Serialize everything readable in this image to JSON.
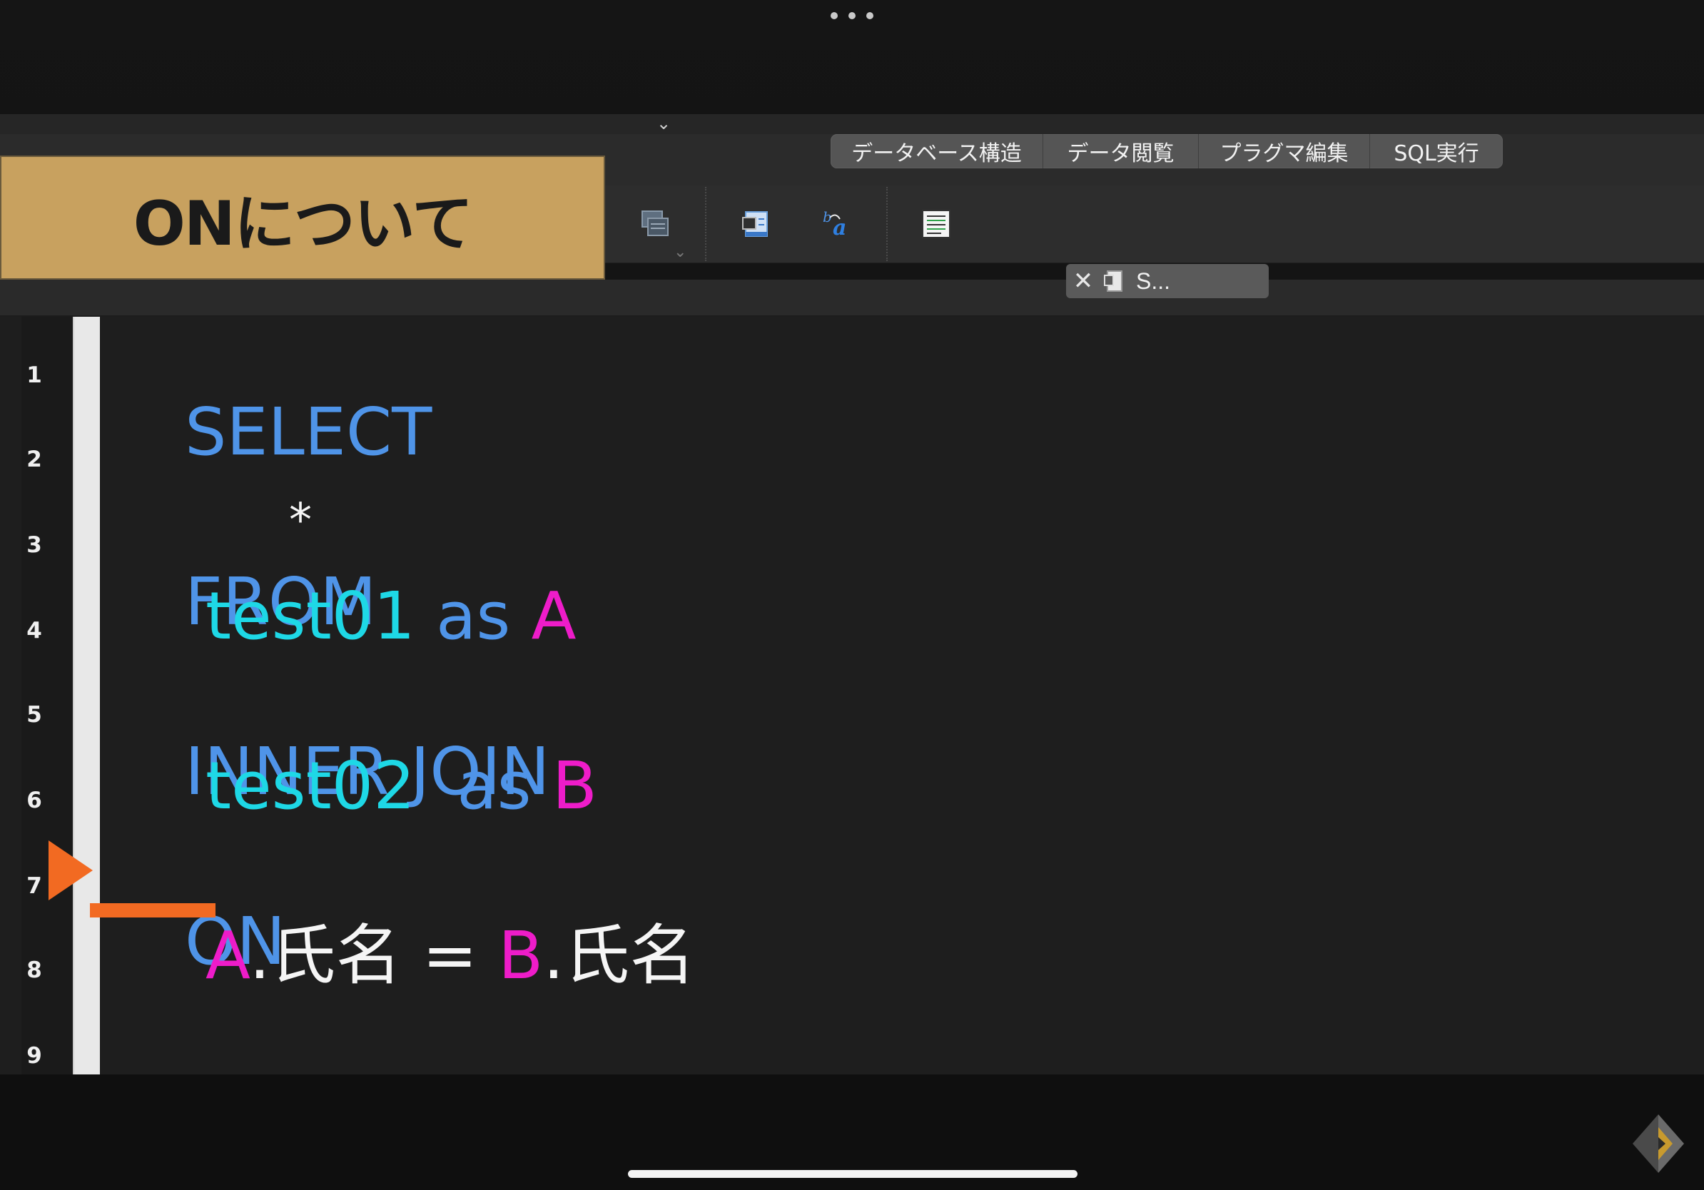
{
  "title_banner": "ONについて",
  "tabs": [
    {
      "label": "データベース構造"
    },
    {
      "label": "データ閲覧"
    },
    {
      "label": "プラグマ編集"
    },
    {
      "label": "SQL実行"
    }
  ],
  "document_tab": {
    "label": "S..."
  },
  "toolbar_icons": [
    "open-tab-icon",
    "open-sql-file-icon",
    "save-sql-icon",
    "find-replace-icon",
    "comment-icon"
  ],
  "editor": {
    "line_numbers": [
      "1",
      "2",
      "3",
      "4",
      "5",
      "6",
      "7",
      "8",
      "9"
    ],
    "line1": {
      "kw": "SELECT"
    },
    "line2": {
      "plain": "*"
    },
    "line3": {
      "kw": "FROM"
    },
    "line4": {
      "tbl": "test01",
      "kw": "as",
      "alias": "A"
    },
    "line5": {
      "kw": "INNER JOIN"
    },
    "line6": {
      "tbl": "test02",
      "kw": "as",
      "alias": "B"
    },
    "line7": {
      "kw": "ON"
    },
    "line8": {
      "alias1": "A",
      "col1": ".氏名",
      "eq": "=",
      "alias2": "B",
      "col2": ".氏名"
    }
  },
  "colors": {
    "keyword": "#4f94e8",
    "table": "#1ed8e6",
    "alias": "#ee1cc9",
    "highlight": "#f26a22",
    "banner": "#c8a15f"
  }
}
